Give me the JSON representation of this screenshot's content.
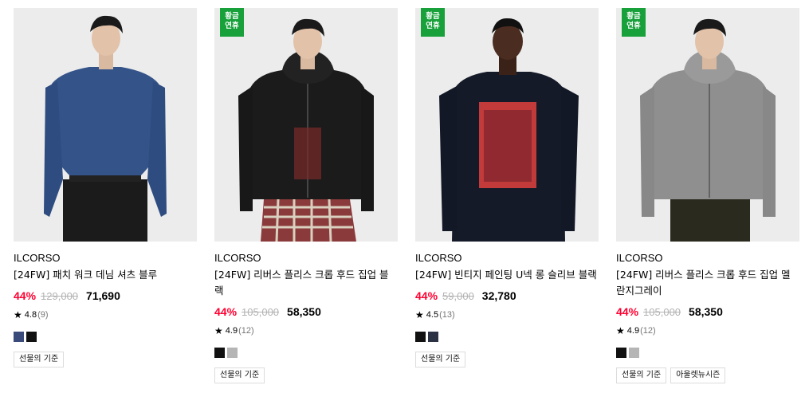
{
  "products": [
    {
      "badge": "",
      "brand": "ILCORSO",
      "title": "[24FW] 패치 워크 데님 셔츠 블루",
      "discount": "44%",
      "original_price": "129,000",
      "price": "71,690",
      "rating": "4.8",
      "reviews": "(9)",
      "swatches": [
        "#3a4a7a",
        "#111111"
      ],
      "tags": [
        "선물의 기준"
      ]
    },
    {
      "badge": "황금\n연휴",
      "brand": "ILCORSO",
      "title": "[24FW] 리버스 플리스 크롭 후드 집업 블랙",
      "discount": "44%",
      "original_price": "105,000",
      "price": "58,350",
      "rating": "4.9",
      "reviews": "(12)",
      "swatches": [
        "#111111",
        "#b5b5b5"
      ],
      "tags": [
        "선물의 기준"
      ]
    },
    {
      "badge": "황금\n연휴",
      "brand": "ILCORSO",
      "title": "[24FW] 빈티지 페인팅 U넥 롱 슬리브 블랙",
      "discount": "44%",
      "original_price": "59,000",
      "price": "32,780",
      "rating": "4.5",
      "reviews": "(13)",
      "swatches": [
        "#111111",
        "#2a3244"
      ],
      "tags": [
        "선물의 기준"
      ]
    },
    {
      "badge": "황금\n연휴",
      "brand": "ILCORSO",
      "title": "[24FW] 리버스 플리스 크롭 후드 집업 멜란지그레이",
      "discount": "44%",
      "original_price": "105,000",
      "price": "58,350",
      "rating": "4.9",
      "reviews": "(12)",
      "swatches": [
        "#111111",
        "#b5b5b5"
      ],
      "tags": [
        "선물의 기준",
        "아울렛뉴시즌"
      ]
    }
  ],
  "icons": {
    "star": "star-icon"
  },
  "colors": {
    "discount": "#ff0030",
    "badge": "#18a03a"
  }
}
